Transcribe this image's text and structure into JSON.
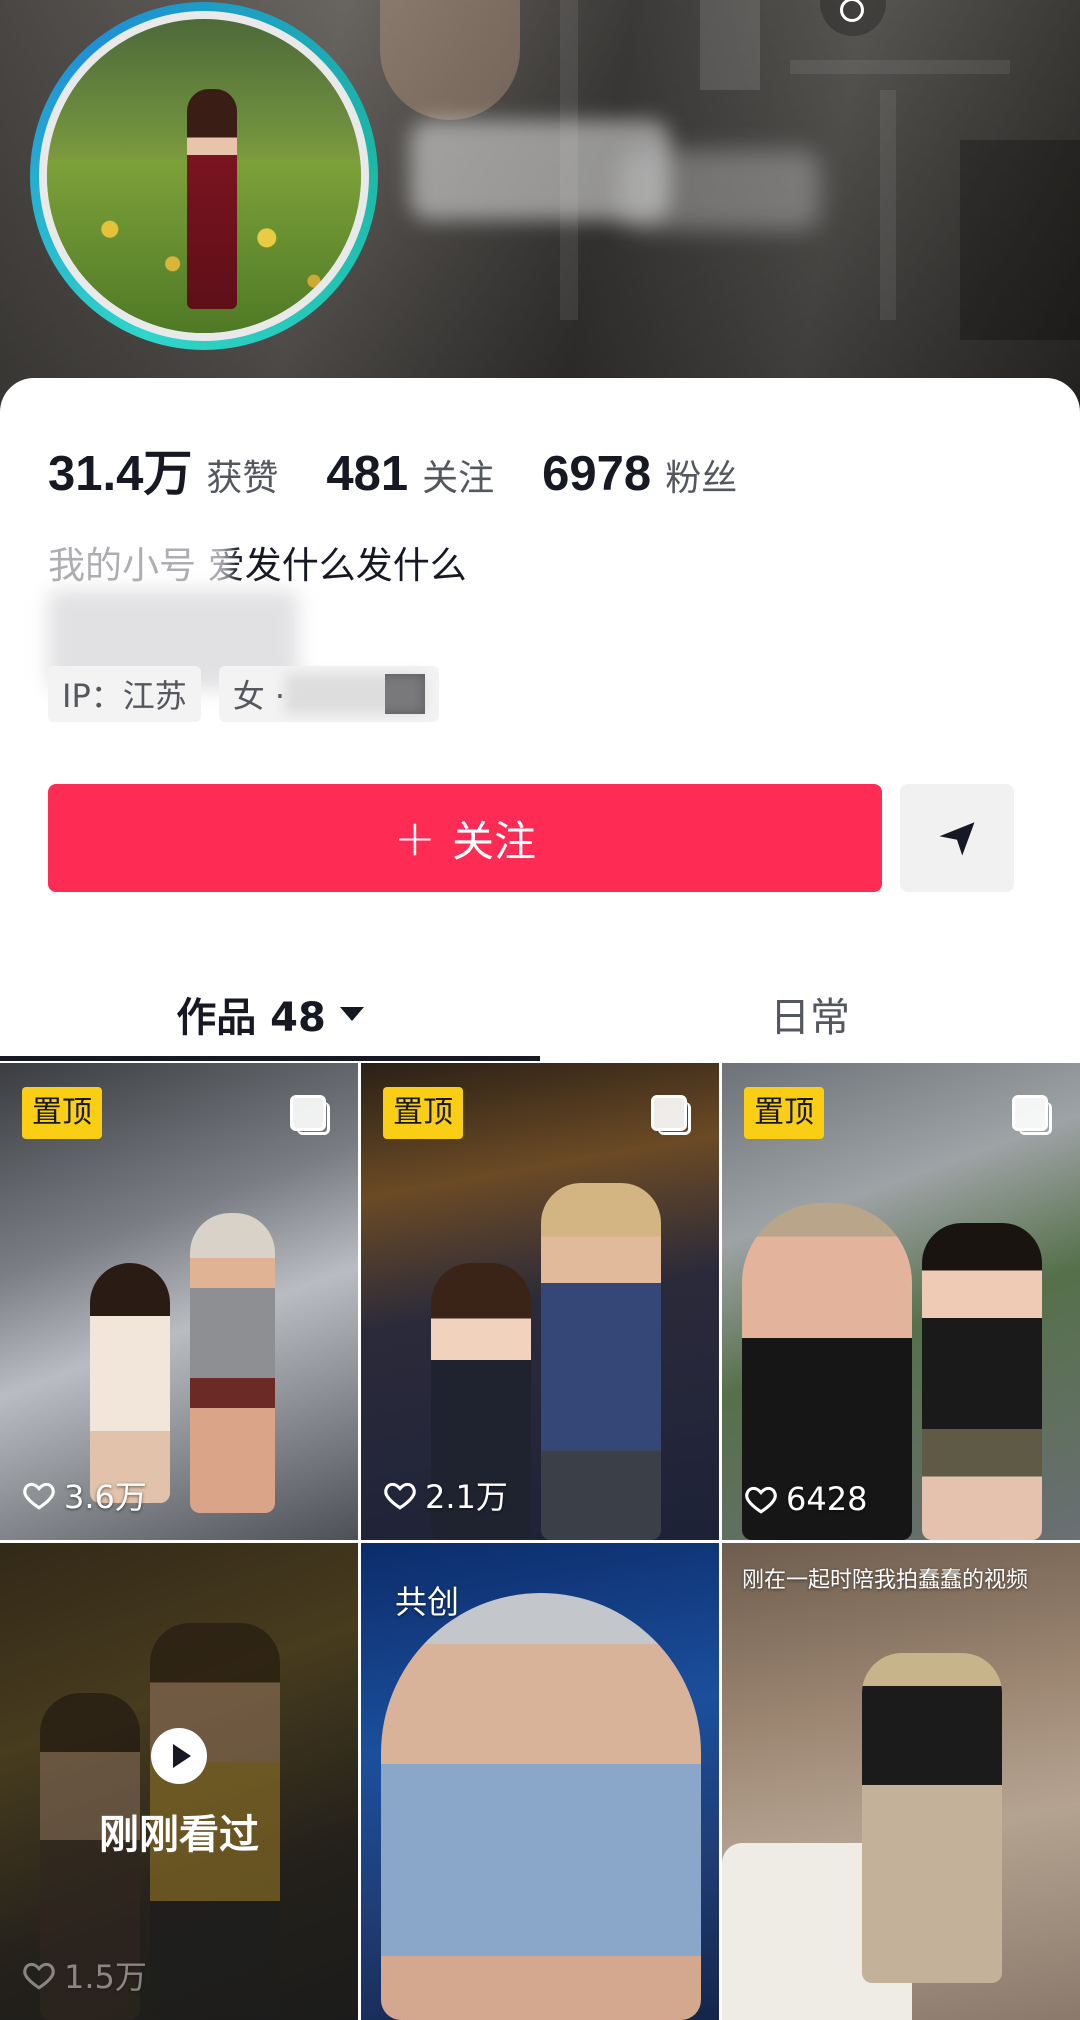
{
  "profile": {
    "stats": [
      {
        "value": "31.4万",
        "label": "获赞"
      },
      {
        "value": "481",
        "label": "关注"
      },
      {
        "value": "6978",
        "label": "粉丝"
      }
    ],
    "bio_line1": "我的小号 爱发什么发什么",
    "tags": {
      "ip": "IP：江苏",
      "gender_age": "女 · "
    }
  },
  "actions": {
    "follow_label": "关注",
    "follow_plus": "+",
    "share_icon": "send-icon"
  },
  "tabs": {
    "works_label": "作品 48",
    "daily_label": "日常"
  },
  "grid": {
    "tiles": [
      {
        "pinned": "置顶",
        "likes": "3.6万",
        "multi_image": true
      },
      {
        "pinned": "置顶",
        "likes": "2.1万",
        "multi_image": true
      },
      {
        "pinned": "置顶",
        "likes": "6428",
        "multi_image": true
      },
      {
        "watched": "刚刚看过",
        "likes": "1.5万"
      },
      {
        "label": "共创"
      },
      {
        "caption": "刚在一起时陪我拍蠢蠢的视频"
      }
    ]
  },
  "colors": {
    "accent": "#fe2c55",
    "pin_badge": "#face15",
    "avatar_ring": "#2fd6c9"
  }
}
